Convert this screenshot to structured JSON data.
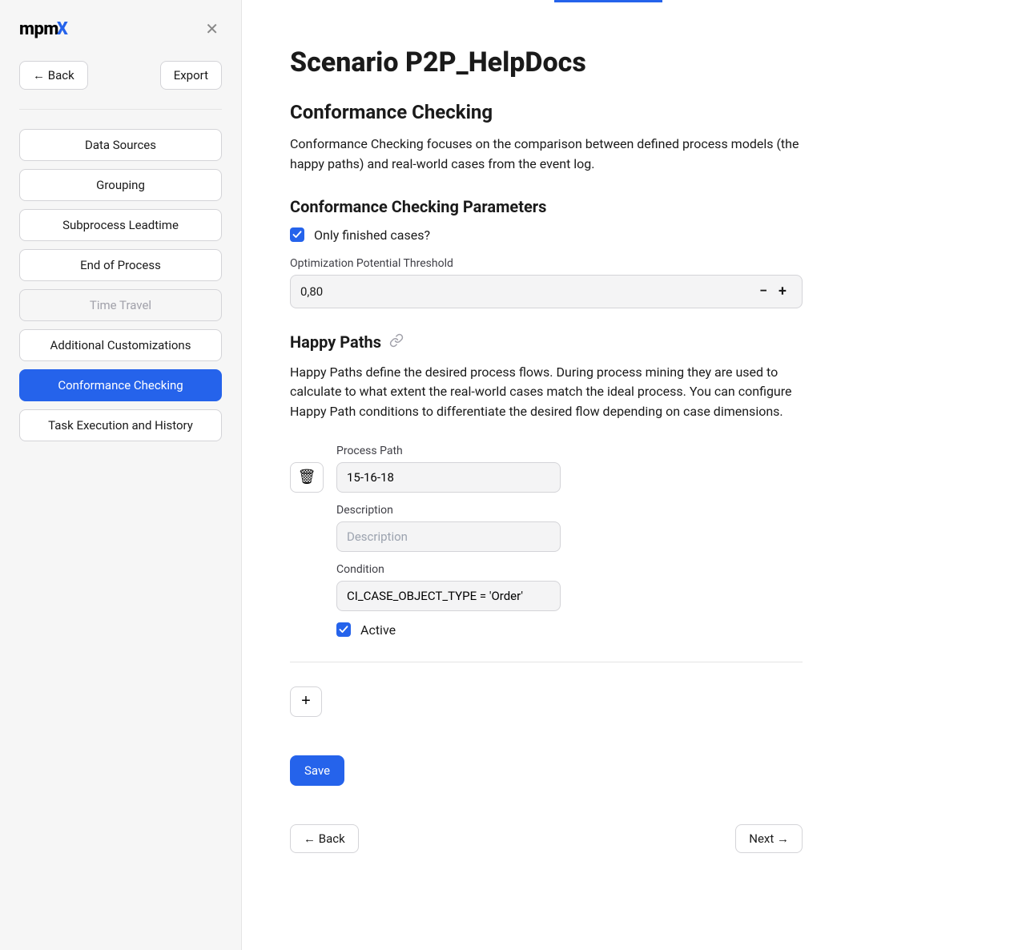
{
  "sidebar": {
    "logo_text": "mpm",
    "back_label": "← Back",
    "export_label": "Export",
    "nav": [
      {
        "label": "Data Sources",
        "state": "normal"
      },
      {
        "label": "Grouping",
        "state": "normal"
      },
      {
        "label": "Subprocess Leadtime",
        "state": "normal"
      },
      {
        "label": "End of Process",
        "state": "normal"
      },
      {
        "label": "Time Travel",
        "state": "disabled"
      },
      {
        "label": "Additional Customizations",
        "state": "normal"
      },
      {
        "label": "Conformance Checking",
        "state": "active"
      },
      {
        "label": "Task Execution and History",
        "state": "normal"
      }
    ]
  },
  "main": {
    "title": "Scenario P2P_HelpDocs",
    "section1_title": "Conformance Checking",
    "section1_desc": "Conformance Checking focuses on the comparison between defined process models (the happy paths) and real-world cases from the event log.",
    "params_title": "Conformance Checking Parameters",
    "only_finished_label": "Only finished cases?",
    "only_finished_checked": true,
    "threshold_label": "Optimization Potential Threshold",
    "threshold_value": "0,80",
    "happy_paths_title": "Happy Paths",
    "happy_paths_desc": "Happy Paths define the desired process flows. During process mining they are used to calculate to what extent the real-world cases match the ideal process. You can configure Happy Path conditions to differentiate the desired flow depending on case dimensions.",
    "path_field_labels": {
      "process_path": "Process Path",
      "description": "Description",
      "condition": "Condition",
      "active": "Active"
    },
    "happy_paths": [
      {
        "process_path": "15-16-18",
        "description": "",
        "description_placeholder": "Description",
        "condition": "CI_CASE_OBJECT_TYPE = 'Order'",
        "active": true
      }
    ],
    "save_label": "Save",
    "footer_back_label": "← Back",
    "footer_next_label": "Next →",
    "add_label": "+"
  }
}
